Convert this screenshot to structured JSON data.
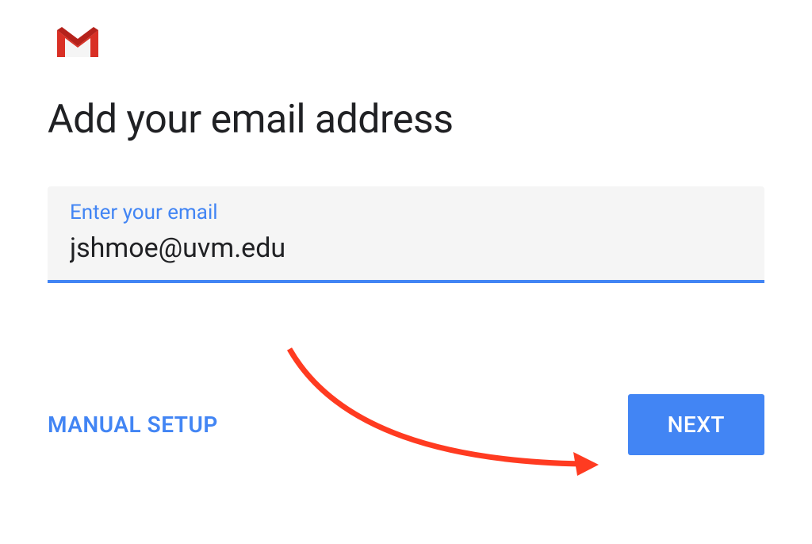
{
  "header": {
    "logo_name": "gmail-icon"
  },
  "title": "Add your email address",
  "email_field": {
    "label": "Enter your email",
    "value": "jshmoe@uvm.edu"
  },
  "actions": {
    "manual_setup_label": "MANUAL SETUP",
    "next_label": "NEXT"
  },
  "colors": {
    "primary": "#4285f4",
    "text": "#202124",
    "input_bg": "#f5f5f5",
    "annotation": "#ff3b21"
  }
}
